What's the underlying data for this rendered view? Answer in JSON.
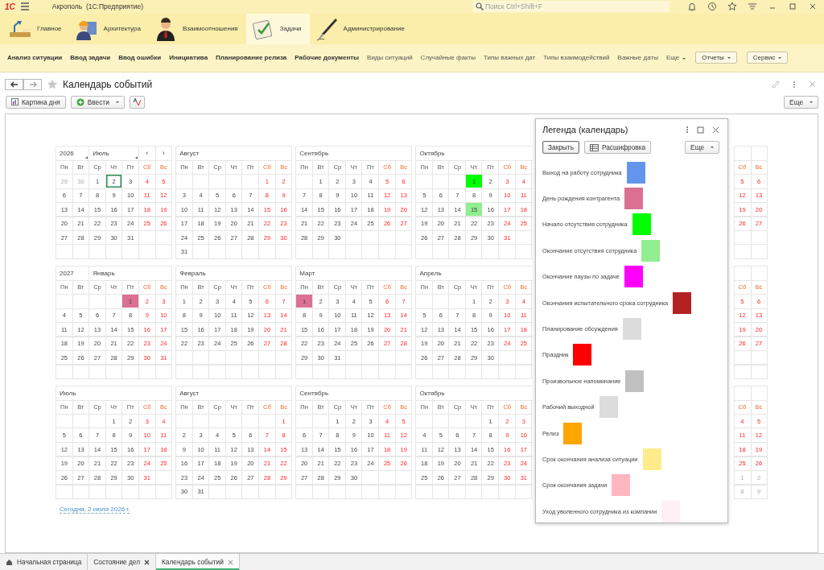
{
  "titlebar": {
    "logo": "1С",
    "title": "Акрополь  (1С:Предприятие)",
    "search": {
      "placeholder": "Поиск Ctrl+Shift+F"
    }
  },
  "sections": [
    {
      "label": "Главное",
      "selected": false
    },
    {
      "label": "Архитектура",
      "selected": false
    },
    {
      "label": "Взаимоотношения",
      "selected": false
    },
    {
      "label": "Задачи",
      "selected": true
    },
    {
      "label": "Администрирование",
      "selected": false
    }
  ],
  "nav": [
    {
      "label": "Анализ ситуации",
      "bold": true,
      "kind": "link"
    },
    {
      "label": "Ввод задачи",
      "bold": true,
      "kind": "link"
    },
    {
      "label": "Ввод ошибки",
      "bold": true,
      "kind": "link"
    },
    {
      "label": "Инициатива",
      "bold": true,
      "kind": "link"
    },
    {
      "label": "Планирование релиза",
      "bold": true,
      "kind": "link"
    },
    {
      "label": "Рабочие документы",
      "bold": true,
      "kind": "link"
    },
    {
      "label": "Виды ситуаций",
      "bold": false,
      "kind": "link"
    },
    {
      "label": "Случайные факты",
      "bold": false,
      "kind": "link"
    },
    {
      "label": "Типы важных дат",
      "bold": false,
      "kind": "link"
    },
    {
      "label": "Типы взаимодействий",
      "bold": false,
      "kind": "link"
    },
    {
      "label": "Важные даты",
      "bold": false,
      "kind": "link"
    },
    {
      "label": "Еще",
      "bold": false,
      "kind": "menu"
    }
  ],
  "nav_buttons": [
    "Отчеты",
    "Сервис"
  ],
  "form": {
    "title": "Календарь событий",
    "toolbar": [
      "Картина дня",
      "Ввести"
    ],
    "more": "Еще"
  },
  "calendar": {
    "rows": [
      {
        "months": [
          {
            "year": "2026",
            "name": "Июль",
            "dropdown": true,
            "arrows": [
              "‹",
              "›"
            ],
            "weekdays": [
              "Пн",
              "Вт",
              "Ср",
              "Чт",
              "Пт",
              "Сб",
              "Вс"
            ],
            "weeks": [
              [
                {
                  "day": "29",
                  "outside": true
                },
                {
                  "day": "30",
                  "outside": true
                },
                "1",
                {
                  "day": "2",
                  "today": true
                },
                "3",
                "4",
                "5"
              ],
              [
                "6",
                "7",
                "8",
                "9",
                "10",
                "11",
                "12"
              ],
              [
                "13",
                "14",
                "15",
                "16",
                "17",
                "18",
                "19"
              ],
              [
                "20",
                "21",
                "22",
                "23",
                "24",
                "25",
                "26"
              ],
              [
                "27",
                "28",
                "29",
                "30",
                "31"
              ]
            ]
          },
          {
            "name": "Август",
            "weekdays": [
              "Пн",
              "Вт",
              "Ср",
              "Чт",
              "Пт",
              "Сб",
              "Вс"
            ],
            "weeks": [
              [
                "1",
                "2"
              ],
              [
                "3",
                "4",
                "5",
                "6",
                "7",
                "8",
                "9"
              ],
              [
                "10",
                "11",
                "12",
                "13",
                "14",
                "15",
                "16"
              ],
              [
                "17",
                "18",
                "19",
                "20",
                "21",
                "22",
                "23"
              ],
              [
                "24",
                "25",
                "26",
                "27",
                "28",
                "29",
                "30"
              ],
              [
                "31"
              ]
            ]
          },
          {
            "name": "Сентябрь",
            "weekdays": [
              "Пн",
              "Вт",
              "Ср",
              "Чт",
              "Пт",
              "Сб",
              "Вс"
            ],
            "weeks": [
              [
                "1",
                "2",
                "3",
                "4",
                "5",
                "6"
              ],
              [
                "7",
                "8",
                "9",
                "10",
                "11",
                "12",
                "13"
              ],
              [
                "14",
                "15",
                "16",
                "17",
                "18",
                "19",
                "20"
              ],
              [
                "21",
                "22",
                "23",
                "24",
                "25",
                "26",
                "27"
              ],
              [
                "28",
                "29",
                "30"
              ]
            ]
          },
          {
            "name": "Октябрь",
            "weekdays": [
              "Пн",
              "Вт",
              "Ср",
              "Чт",
              "Пт",
              "Сб",
              "Вс"
            ],
            "weeks": [
              [
                {
                  "day": "1",
                  "color": "#00ff00"
                },
                "2",
                "3",
                "4"
              ],
              [
                "5",
                "6",
                "7",
                "8",
                "9",
                "10",
                "11"
              ],
              [
                "12",
                "13",
                "14",
                {
                  "day": "15",
                  "color": "#90ee90"
                },
                "16",
                "17",
                "18"
              ],
              [
                "19",
                "20",
                "21",
                "22",
                "23",
                "24",
                "25"
              ],
              [
                "26",
                "27",
                "28",
                "29",
                "30",
                "31"
              ]
            ]
          }
        ],
        "partial": {
          "weekdays": [
            "Сб",
            "Вс"
          ],
          "weeks": [
            [
              "5",
              "6"
            ],
            [
              "12",
              "13"
            ],
            [
              "19",
              "20"
            ],
            [
              "26",
              "27"
            ]
          ]
        }
      },
      {
        "months": [
          {
            "year": "2027",
            "name": "Январь",
            "dropdown": false,
            "weekdays": [
              "Пн",
              "Вт",
              "Ср",
              "Чт",
              "Пт",
              "Сб",
              "Вс"
            ],
            "weeks": [
              [
                {
                  "day": "1",
                  "color": "#db7093"
                },
                "2",
                "3"
              ],
              [
                "4",
                "5",
                "6",
                "7",
                "8",
                "9",
                "10"
              ],
              [
                "11",
                "12",
                "13",
                "14",
                "15",
                "16",
                "17"
              ],
              [
                "18",
                "19",
                "20",
                "21",
                "22",
                "23",
                "24"
              ],
              [
                "25",
                "26",
                "27",
                "28",
                "29",
                "30",
                "31"
              ]
            ]
          },
          {
            "name": "Февраль",
            "weekdays": [
              "Пн",
              "Вт",
              "Ср",
              "Чт",
              "Пт",
              "Сб",
              "Вс"
            ],
            "weeks": [
              [
                "1",
                "2",
                "3",
                "4",
                "5",
                "6",
                "7"
              ],
              [
                "8",
                "9",
                "10",
                "11",
                "12",
                "13",
                "14"
              ],
              [
                "15",
                "16",
                "17",
                "18",
                "19",
                "20",
                "21"
              ],
              [
                "22",
                "23",
                "24",
                "25",
                "26",
                "27",
                "28"
              ]
            ]
          },
          {
            "name": "Март",
            "weekdays": [
              "Пн",
              "Вт",
              "Ср",
              "Чт",
              "Пт",
              "Сб",
              "Вс"
            ],
            "weeks": [
              [
                {
                  "day": "1",
                  "color": "#db7093"
                },
                "2",
                "3",
                "4",
                "5",
                "6",
                "7"
              ],
              [
                "8",
                "9",
                "10",
                "11",
                "12",
                "13",
                "14"
              ],
              [
                "15",
                "16",
                "17",
                "18",
                "19",
                "20",
                "21"
              ],
              [
                "22",
                "23",
                "24",
                "25",
                "26",
                "27",
                "28"
              ],
              [
                "29",
                "30",
                "31"
              ]
            ]
          },
          {
            "name": "Апрель",
            "weekdays": [
              "Пн",
              "Вт",
              "Ср",
              "Чт",
              "Пт",
              "Сб",
              "Вс"
            ],
            "weeks": [
              [
                "1",
                "2",
                "3",
                "4"
              ],
              [
                "5",
                "6",
                "7",
                "8",
                "9",
                "10",
                "11"
              ],
              [
                "12",
                "13",
                "14",
                "15",
                "16",
                "17",
                "18"
              ],
              [
                "19",
                "20",
                "21",
                "22",
                "23",
                "24",
                "25"
              ],
              [
                "26",
                "27",
                "28",
                "29",
                "30"
              ]
            ]
          }
        ],
        "partial": {
          "weekdays": [
            "Сб",
            "Вс"
          ],
          "weeks": [
            [
              "5",
              "6"
            ],
            [
              "12",
              "13"
            ],
            [
              "19",
              "20"
            ],
            [
              "26",
              "27"
            ]
          ]
        }
      },
      {
        "months": [
          {
            "name": "Июль",
            "weekdays": [
              "Пн",
              "Вт",
              "Ср",
              "Чт",
              "Пт",
              "Сб",
              "Вс"
            ],
            "weeks": [
              [
                "1",
                "2",
                "3",
                "4"
              ],
              [
                "5",
                "6",
                "7",
                "8",
                "9",
                "10",
                "11"
              ],
              [
                "12",
                "13",
                "14",
                "15",
                "16",
                "17",
                "18"
              ],
              [
                "19",
                "20",
                "21",
                "22",
                "23",
                "24",
                "25"
              ],
              [
                "26",
                "27",
                "28",
                "29",
                "30",
                "31"
              ]
            ]
          },
          {
            "name": "Август",
            "weekdays": [
              "Пн",
              "Вт",
              "Ср",
              "Чт",
              "Пт",
              "Сб",
              "Вс"
            ],
            "weeks": [
              [
                "1"
              ],
              [
                "2",
                "3",
                "4",
                "5",
                "6",
                "7",
                "8"
              ],
              [
                "9",
                "10",
                "11",
                "12",
                "13",
                "14",
                "15"
              ],
              [
                "16",
                "17",
                "18",
                "19",
                "20",
                "21",
                "22"
              ],
              [
                "23",
                "24",
                "25",
                "26",
                "27",
                "28",
                "29"
              ],
              [
                "30",
                "31"
              ]
            ]
          },
          {
            "name": "Сентябрь",
            "weekdays": [
              "Пн",
              "Вт",
              "Ср",
              "Чт",
              "Пт",
              "Сб",
              "Вс"
            ],
            "weeks": [
              [
                "1",
                "2",
                "3",
                "4",
                "5"
              ],
              [
                "6",
                "7",
                "8",
                "9",
                "10",
                "11",
                "12"
              ],
              [
                "13",
                "14",
                "15",
                "16",
                "17",
                "18",
                "19"
              ],
              [
                "20",
                "21",
                "22",
                "23",
                "24",
                "25",
                "26"
              ],
              [
                "27",
                "28",
                "29",
                "30"
              ]
            ]
          },
          {
            "name": "Октябрь",
            "weekdays": [
              "Пн",
              "Вт",
              "Ср",
              "Чт",
              "Пт",
              "Сб",
              "Вс"
            ],
            "weeks": [
              [
                "1",
                "2",
                "3"
              ],
              [
                "4",
                "5",
                "6",
                "7",
                "8",
                "9",
                "10"
              ],
              [
                "11",
                "12",
                "13",
                "14",
                "15",
                "16",
                "17"
              ],
              [
                "18",
                "19",
                "20",
                "21",
                "22",
                "23",
                "24"
              ],
              [
                "25",
                "26",
                "27",
                "28",
                "29",
                "30",
                "31"
              ]
            ]
          }
        ],
        "partial": {
          "weekdays": [
            "Сб",
            "Вс"
          ],
          "weeks": [
            [
              "4",
              "5"
            ],
            [
              "11",
              "12"
            ],
            [
              "18",
              "19"
            ],
            [
              "25",
              "26"
            ],
            [
              {
                "day": "1",
                "outside": true
              },
              {
                "day": "2",
                "outside": true
              }
            ],
            [
              {
                "day": "8",
                "outside": true
              },
              {
                "day": "9",
                "outside": true
              }
            ]
          ]
        }
      }
    ],
    "today_link": "Сегодня, 2 июля 2026 г."
  },
  "legend": {
    "title": "Легенда (календарь)",
    "buttons": [
      "Закрыть",
      "Расшифровка"
    ],
    "more": "Еще",
    "items": [
      {
        "label": "Выход на работу сотрудника",
        "color": "#6495ed"
      },
      {
        "label": "День рождения контрагента",
        "color": "#db7093"
      },
      {
        "label": "Начало отсутствия сотрудника",
        "color": "#00ff00"
      },
      {
        "label": "Окончание отсутствия сотрудника",
        "color": "#90ee90"
      },
      {
        "label": "Окончание паузы по задаче",
        "color": "#ff00ff"
      },
      {
        "label": "Окончания испытательного срока сотрудника",
        "color": "#b22222"
      },
      {
        "label": "Планирование обсуждения",
        "color": "#dcdcdc"
      },
      {
        "label": "Праздник",
        "color": "#ff0000"
      },
      {
        "label": "Произвольное напоминание",
        "color": "#c0c0c0"
      },
      {
        "label": "Рабочий выходной",
        "color": "#dcdcdc"
      },
      {
        "label": "Релиз",
        "color": "#ffa500"
      },
      {
        "label": "Срок окончания анализа ситуации",
        "color": "#ffeb8a"
      },
      {
        "label": "Срок окончания задачи",
        "color": "#ffb6c1"
      },
      {
        "label": "Уход уволенного сотрудника из компании",
        "color": "#fff0f5"
      }
    ]
  },
  "tabs": [
    {
      "label": "Начальная страница",
      "selected": false,
      "closable": false
    },
    {
      "label": "Состояние дел",
      "selected": false,
      "closable": true
    },
    {
      "label": "Календарь событий",
      "selected": true,
      "closable": true
    }
  ]
}
